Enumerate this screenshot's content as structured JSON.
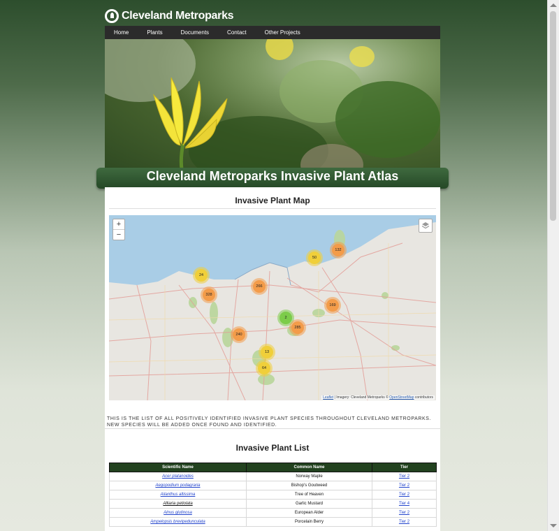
{
  "brand": {
    "name": "Cleveland Metroparks"
  },
  "nav": {
    "items": [
      "Home",
      "Plants",
      "Documents",
      "Contact",
      "Other Projects"
    ]
  },
  "banner": {
    "title": "Cleveland Metroparks Invasive Plant Atlas"
  },
  "map_section": {
    "heading": "Invasive Plant Map",
    "zoom_in": "+",
    "zoom_out": "−",
    "attribution": {
      "link1": "Leaflet",
      "middle": " | Imagery: Cleveland Metroparks © ",
      "link2": "OpenStreetMap",
      "end": " contributors"
    },
    "clusters": [
      {
        "count": "132",
        "color": "#f39c4a"
      },
      {
        "count": "50",
        "color": "#f0cf3a"
      },
      {
        "count": "24",
        "color": "#f0cf3a"
      },
      {
        "count": "266",
        "color": "#f39c4a"
      },
      {
        "count": "328",
        "color": "#f39c4a"
      },
      {
        "count": "169",
        "color": "#f39c4a"
      },
      {
        "count": "2",
        "color": "#7ccc4a"
      },
      {
        "count": "285",
        "color": "#f39c4a"
      },
      {
        "count": "240",
        "color": "#f39c4a"
      },
      {
        "count": "13",
        "color": "#f0cf3a"
      },
      {
        "count": "64",
        "color": "#f0cf3a"
      }
    ]
  },
  "description": "This is the list of all positively identified invasive plant species throughout Cleveland Metroparks. New species will be added once found and identified.",
  "list_section": {
    "heading": "Invasive Plant List",
    "columns": [
      "Scientific Name",
      "Common Name",
      "Tier"
    ],
    "rows": [
      {
        "scientific": "Acer platanoides",
        "common": "Norway Maple",
        "tier": "Tier 2"
      },
      {
        "scientific": "Aegopodium podagraria",
        "common": "Bishop's Goutweed",
        "tier": "Tier 2"
      },
      {
        "scientific": "Ailanthus altissima",
        "common": "Tree of Heaven",
        "tier": "Tier 2"
      },
      {
        "scientific": "Alliaria petiolata",
        "common": "Garlic Mustard",
        "tier": "Tier 4"
      },
      {
        "scientific": "Alnus glutinosa",
        "common": "European Alder",
        "tier": "Tier 2"
      },
      {
        "scientific": "Ampelopsis brevipedunculata",
        "common": "Porcelain Berry",
        "tier": "Tier 2"
      }
    ]
  },
  "colors": {
    "header_green": "#22421f",
    "banner_green": "#2f5a31",
    "link_blue": "#2244cc",
    "lake_blue": "#a9cde6"
  }
}
